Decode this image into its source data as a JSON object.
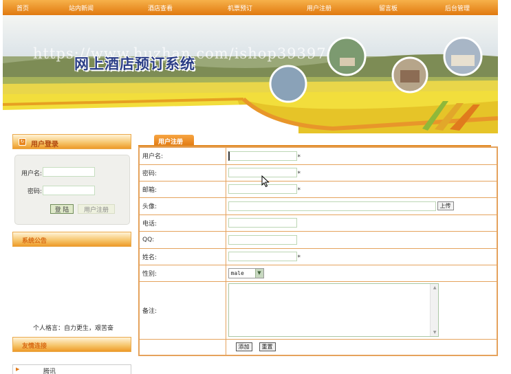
{
  "nav": {
    "items": [
      {
        "label": "首页"
      },
      {
        "label": "站内新闻"
      },
      {
        "label": "酒店查看"
      },
      {
        "label": "机票预订"
      },
      {
        "label": "用户注册"
      },
      {
        "label": "留言板"
      },
      {
        "label": "后台管理"
      }
    ]
  },
  "banner": {
    "watermark": "https://www.huzhan.com/ishop39397",
    "title": "网上酒店预订系统"
  },
  "login": {
    "title": "用户登录",
    "username_label": "用户名:",
    "password_label": "密码:",
    "login_button": "登 陆",
    "register_button": "用户注册"
  },
  "notice": {
    "title": "系统公告",
    "motto": "个人格言：自力更生，艰苦奋"
  },
  "links": {
    "title": "友情连接",
    "items": [
      {
        "label": "腾讯"
      }
    ]
  },
  "register": {
    "tab": "用户注册",
    "fields": {
      "username": "用户名:",
      "password": "密码:",
      "email": "邮箱:",
      "avatar": "头像:",
      "phone": "电话:",
      "qq": "QQ:",
      "name": "姓名:",
      "gender": "性别:",
      "note": "备注:"
    },
    "required_mark": "*",
    "upload_button": "上传",
    "gender_value": "male",
    "add_button": "添加",
    "reset_button": "重置"
  },
  "colors": {
    "nav_orange": "#e88b1e",
    "border_orange": "#e5a25c",
    "input_border": "#bcd6b4"
  }
}
